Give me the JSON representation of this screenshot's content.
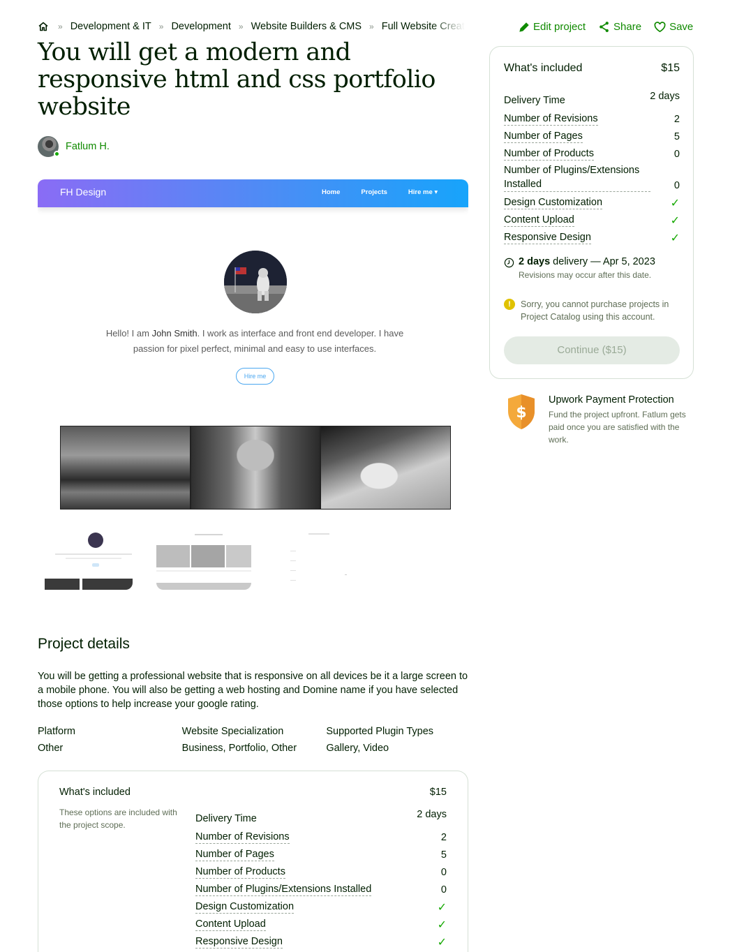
{
  "breadcrumbs": [
    "Development & IT",
    "Development",
    "Website Builders & CMS",
    "Full Website Creat"
  ],
  "actions": {
    "edit": "Edit project",
    "share": "Share",
    "save": "Save"
  },
  "title": "You will get a modern and responsive html and css portfolio website",
  "seller": {
    "name": "Fatlum H."
  },
  "preview": {
    "brand": "FH Design",
    "nav": [
      "Home",
      "Projects",
      "Hire me"
    ],
    "intro_pre": "Hello! I am ",
    "intro_name": "John Smith",
    "intro_post": ". I work as interface and front end developer. I have passion for pixel perfect, minimal and easy to use interfaces.",
    "hire": "Hire me"
  },
  "included": {
    "heading": "What's included",
    "price": "$15",
    "rows": [
      {
        "label": "Delivery Time",
        "value": "2 days"
      },
      {
        "label": "Number of Revisions",
        "value": "2"
      },
      {
        "label": "Number of Pages",
        "value": "5"
      },
      {
        "label": "Number of Products",
        "value": "0"
      },
      {
        "label": "Number of Plugins/Extensions Installed",
        "value": "0"
      },
      {
        "label": "Design Customization",
        "value": "✓"
      },
      {
        "label": "Content Upload",
        "value": "✓"
      },
      {
        "label": "Responsive Design",
        "value": "✓"
      }
    ],
    "delivery_bold": "2 days",
    "delivery_rest": " delivery — Apr 5, 2023",
    "delivery_note": "Revisions may occur after this date.",
    "warning": "Sorry, you cannot purchase projects in Project Catalog using this account.",
    "continue": "Continue ($15)"
  },
  "protection": {
    "title": "Upwork Payment Protection",
    "text": "Fund the project upfront. Fatlum gets paid once you are satisfied with the work."
  },
  "details": {
    "title": "Project details",
    "description": "You will be getting a professional website that is responsive on all devices be it a large screen to a mobile phone. You will also be getting a web hosting and Domine name if you have selected those options to help increase your google rating.",
    "attributes": [
      {
        "label": "Platform",
        "value": "Other"
      },
      {
        "label": "Website Specialization",
        "value": "Business, Portfolio, Other"
      },
      {
        "label": "Supported Plugin Types",
        "value": "Gallery, Video"
      }
    ]
  },
  "included2": {
    "heading": "What's included",
    "subtext": "These options are included with the project scope.",
    "price": "$15"
  },
  "colors": {
    "brand_green": "#108a00",
    "check_green": "#14a800",
    "border": "#d5e0d5"
  }
}
